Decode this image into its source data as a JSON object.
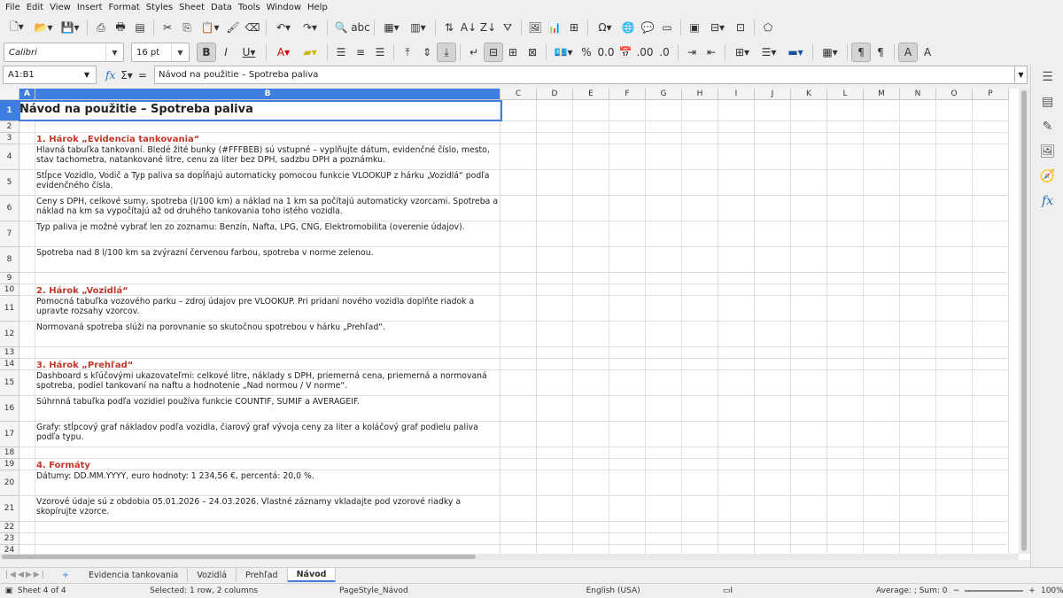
{
  "menu": [
    "File",
    "Edit",
    "View",
    "Insert",
    "Format",
    "Styles",
    "Sheet",
    "Data",
    "Tools",
    "Window",
    "Help"
  ],
  "format": {
    "font_name": "Calibri",
    "font_size": "16 pt"
  },
  "formula_bar": {
    "name_box": "A1:B1",
    "content": "Návod na použitie – Spotreba paliva"
  },
  "columns": [
    "A",
    "B",
    "C",
    "D",
    "E",
    "F",
    "G",
    "H",
    "I",
    "J",
    "K",
    "L",
    "M",
    "N",
    "O",
    "P"
  ],
  "rows": [
    {
      "n": "1",
      "text": "Návod na použitie – Spotreba paliva",
      "style": "title"
    },
    {
      "n": "2",
      "text": ""
    },
    {
      "n": "3",
      "text": "1. Hárok „Evidencia tankovania“",
      "style": "head"
    },
    {
      "n": "4",
      "text": "Hlavná tabuľka tankovaní. Bledé žlté bunky (#FFFBEB) sú vstupné – vyplňujte dátum, evidenčné číslo, mesto, stav tachometra, natankované litre, cenu za liter bez DPH, sadzbu DPH a poznámku."
    },
    {
      "n": "5",
      "text": "Stĺpce Vozidlo, Vodič a Typ paliva sa dopĺňajú automaticky pomocou funkcie VLOOKUP z hárku „Vozidlá“ podľa evidenčného čísla."
    },
    {
      "n": "6",
      "text": "Ceny s DPH, celkové sumy, spotreba (l/100 km) a náklad na 1 km sa počítajú automaticky vzorcami. Spotreba a náklad na km sa vypočítajú až od druhého tankovania toho istého vozidla."
    },
    {
      "n": "7",
      "text": "Typ paliva je možné vybrať len zo zoznamu: Benzín, Nafta, LPG, CNG, Elektromobilita (overenie údajov)."
    },
    {
      "n": "8",
      "text": "Spotreba nad 8 l/100 km sa zvýrazní červenou farbou, spotreba v norme zelenou."
    },
    {
      "n": "9",
      "text": ""
    },
    {
      "n": "10",
      "text": "2. Hárok „Vozidlá“",
      "style": "head"
    },
    {
      "n": "11",
      "text": "Pomocná tabuľka vozového parku – zdroj údajov pre VLOOKUP. Pri pridaní nového vozidla doplňte riadok a upravte rozsahy vzorcov."
    },
    {
      "n": "12",
      "text": "Normovaná spotreba slúži na porovnanie so skutočnou spotrebou v hárku „Prehľad“."
    },
    {
      "n": "13",
      "text": ""
    },
    {
      "n": "14",
      "text": "3. Hárok „Prehľad“",
      "style": "head"
    },
    {
      "n": "15",
      "text": "Dashboard s kľúčovými ukazovateľmi: celkové litre, náklady s DPH, priemerná cena, priemerná a normovaná spotreba, podiel tankovaní na naftu a hodnotenie „Nad normou / V norme“."
    },
    {
      "n": "16",
      "text": "Súhrnná tabuľka podľa vozidiel používa funkcie COUNTIF, SUMIF a AVERAGEIF."
    },
    {
      "n": "17",
      "text": "Grafy: stĺpcový graf nákladov podľa vozidla, čiarový graf vývoja ceny za liter a koláčový graf podielu paliva podľa typu."
    },
    {
      "n": "18",
      "text": ""
    },
    {
      "n": "19",
      "text": "4. Formáty",
      "style": "head"
    },
    {
      "n": "20",
      "text": "Dátumy: DD.MM.YYYY, euro hodnoty: 1 234,56 €, percentá: 20,0 %."
    },
    {
      "n": "21",
      "text": "Vzorové údaje sú z obdobia 05.01.2026 – 24.03.2026. Vlastné záznamy vkladajte pod vzorové riadky a skopírujte vzorce."
    },
    {
      "n": "22",
      "text": ""
    },
    {
      "n": "23",
      "text": ""
    },
    {
      "n": "24",
      "text": ""
    }
  ],
  "sheets": [
    "Evidencia tankovania",
    "Vozidlá",
    "Prehľad",
    "Návod"
  ],
  "active_sheet": "Návod",
  "status": {
    "sheet": "Sheet 4 of 4",
    "selection": "Selected: 1 row, 2 columns",
    "page_style": "PageStyle_Návod",
    "language": "English (USA)",
    "sum": "Average: ; Sum: 0",
    "zoom": "100%"
  },
  "colors": {
    "accent": "#3d7ee0",
    "heading": "#c0392b"
  }
}
